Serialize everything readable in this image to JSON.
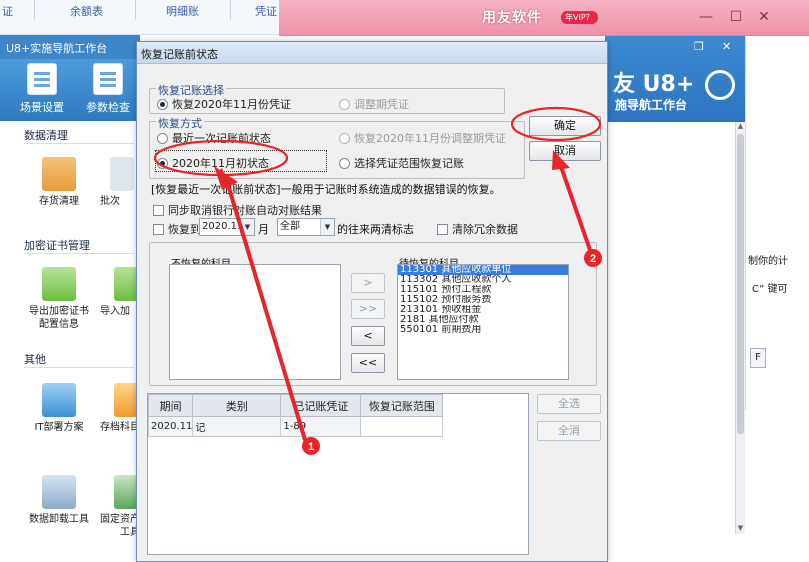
{
  "top_strip": {
    "tabs": [
      "证",
      "余额表",
      "明细账",
      "凭证"
    ]
  },
  "pink_window": {
    "title": "用友软件",
    "vip": "年VIP？",
    "min": "—",
    "max": "☐",
    "close": "✕"
  },
  "u8_window": {
    "title": "U8+实施导航工作台",
    "toolbar": [
      {
        "label": "场景设置"
      },
      {
        "label": "参数检查"
      }
    ],
    "sections": {
      "data_clean": "数据清理",
      "cert": "加密证书管理",
      "other": "其他"
    },
    "items": {
      "inventory_clean": "存货清理",
      "batch": "批次",
      "export_cert_line1": "导出加密证书",
      "export_cert_line2": "配置信息",
      "import_cert": "导入加",
      "it_plan": "IT部署方案",
      "archive": "存档科目",
      "data_unload": "数据卸载工具",
      "fixed_asset_line1": "固定资产",
      "fixed_asset_line2": "工具"
    },
    "brand_big": "友 U8+",
    "brand_sub": "施导航工作台",
    "right_text_1": "制你的计",
    "right_text_2": "C” 键可",
    "right_btn": "F"
  },
  "dialog": {
    "title": "恢复记账前状态",
    "group_selection": {
      "legend": "恢复记账选择",
      "options": [
        {
          "label": "恢复2020年11月份凭证",
          "selected": true,
          "enabled": true
        },
        {
          "label": "调整期凭证",
          "selected": false,
          "enabled": false
        }
      ]
    },
    "group_method": {
      "legend": "恢复方式",
      "options": [
        {
          "label": "最近一次记账前状态",
          "selected": false,
          "enabled": true
        },
        {
          "label": "恢复2020年11月份调整期凭证",
          "selected": false,
          "enabled": false
        },
        {
          "label": "2020年11月初状态",
          "selected": true,
          "enabled": true
        },
        {
          "label": "选择凭证范围恢复记账",
          "selected": false,
          "enabled": true
        }
      ]
    },
    "ok_label": "确定",
    "cancel_label": "取消",
    "description": "[恢复最近一次记账前状态]一般用于记账时系统造成的数据错误的恢复。",
    "sync_cancel_label": "同步取消银行对账自动对账结果",
    "restore_to_label": "恢复到",
    "restore_year": "2020.11",
    "month_label": "月",
    "restore_scope": "全部",
    "suffix_label": "的往来两清标志",
    "clear_redundant_label": "清除冗余数据",
    "left_list_header": "不恢复的科目",
    "right_list_header": "待恢复的科目",
    "right_list_items": [
      "113301 其他应收款单位",
      "113302 其他应收款个人",
      "115101 预付工程款",
      "115102 预付服务费",
      "213101 预收租金",
      "2181 其他应付款",
      "550101 前期费用"
    ],
    "move_buttons": [
      ">",
      ">>",
      "<",
      "<<"
    ],
    "grid": {
      "columns": [
        "期间",
        "类别",
        "已记账凭证",
        "恢复记账范围"
      ],
      "rows": [
        [
          "2020.11",
          "记",
          "1-89",
          ""
        ]
      ]
    },
    "select_all_label": "全选",
    "clear_all_label": "全消"
  },
  "annotations": {
    "marker_1": "1",
    "marker_2": "2",
    "color": "#e8252b"
  }
}
